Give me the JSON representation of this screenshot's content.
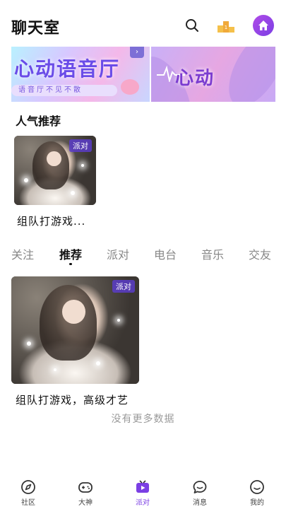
{
  "header": {
    "title": "聊天室"
  },
  "banners": [
    {
      "title": "心动语音厅",
      "subtitle": "语音厅不见不散"
    },
    {
      "title": "心动"
    }
  ],
  "popular": {
    "section_title": "人气推荐",
    "cards": [
      {
        "tag": "派对",
        "label": "组队打游戏..."
      }
    ]
  },
  "tabs": [
    {
      "label": "关注",
      "active": false
    },
    {
      "label": "推荐",
      "active": true
    },
    {
      "label": "派对",
      "active": false
    },
    {
      "label": "电台",
      "active": false
    },
    {
      "label": "音乐",
      "active": false
    },
    {
      "label": "交友",
      "active": false
    }
  ],
  "feed": {
    "cards": [
      {
        "tag": "派对",
        "label": "组队打游戏，高级才艺"
      }
    ],
    "empty_text": "没有更多数据"
  },
  "tabbar": {
    "items": [
      {
        "label": "社区",
        "icon": "compass-icon",
        "active": false
      },
      {
        "label": "大神",
        "icon": "gamepad-icon",
        "active": false
      },
      {
        "label": "派对",
        "icon": "tv-play-icon",
        "active": true
      },
      {
        "label": "消息",
        "icon": "chat-bubble-icon",
        "active": false
      },
      {
        "label": "我的",
        "icon": "smile-face-icon",
        "active": false
      }
    ]
  },
  "colors": {
    "accent": "#7b3fe4",
    "rank_icon": "#f0a93a"
  }
}
